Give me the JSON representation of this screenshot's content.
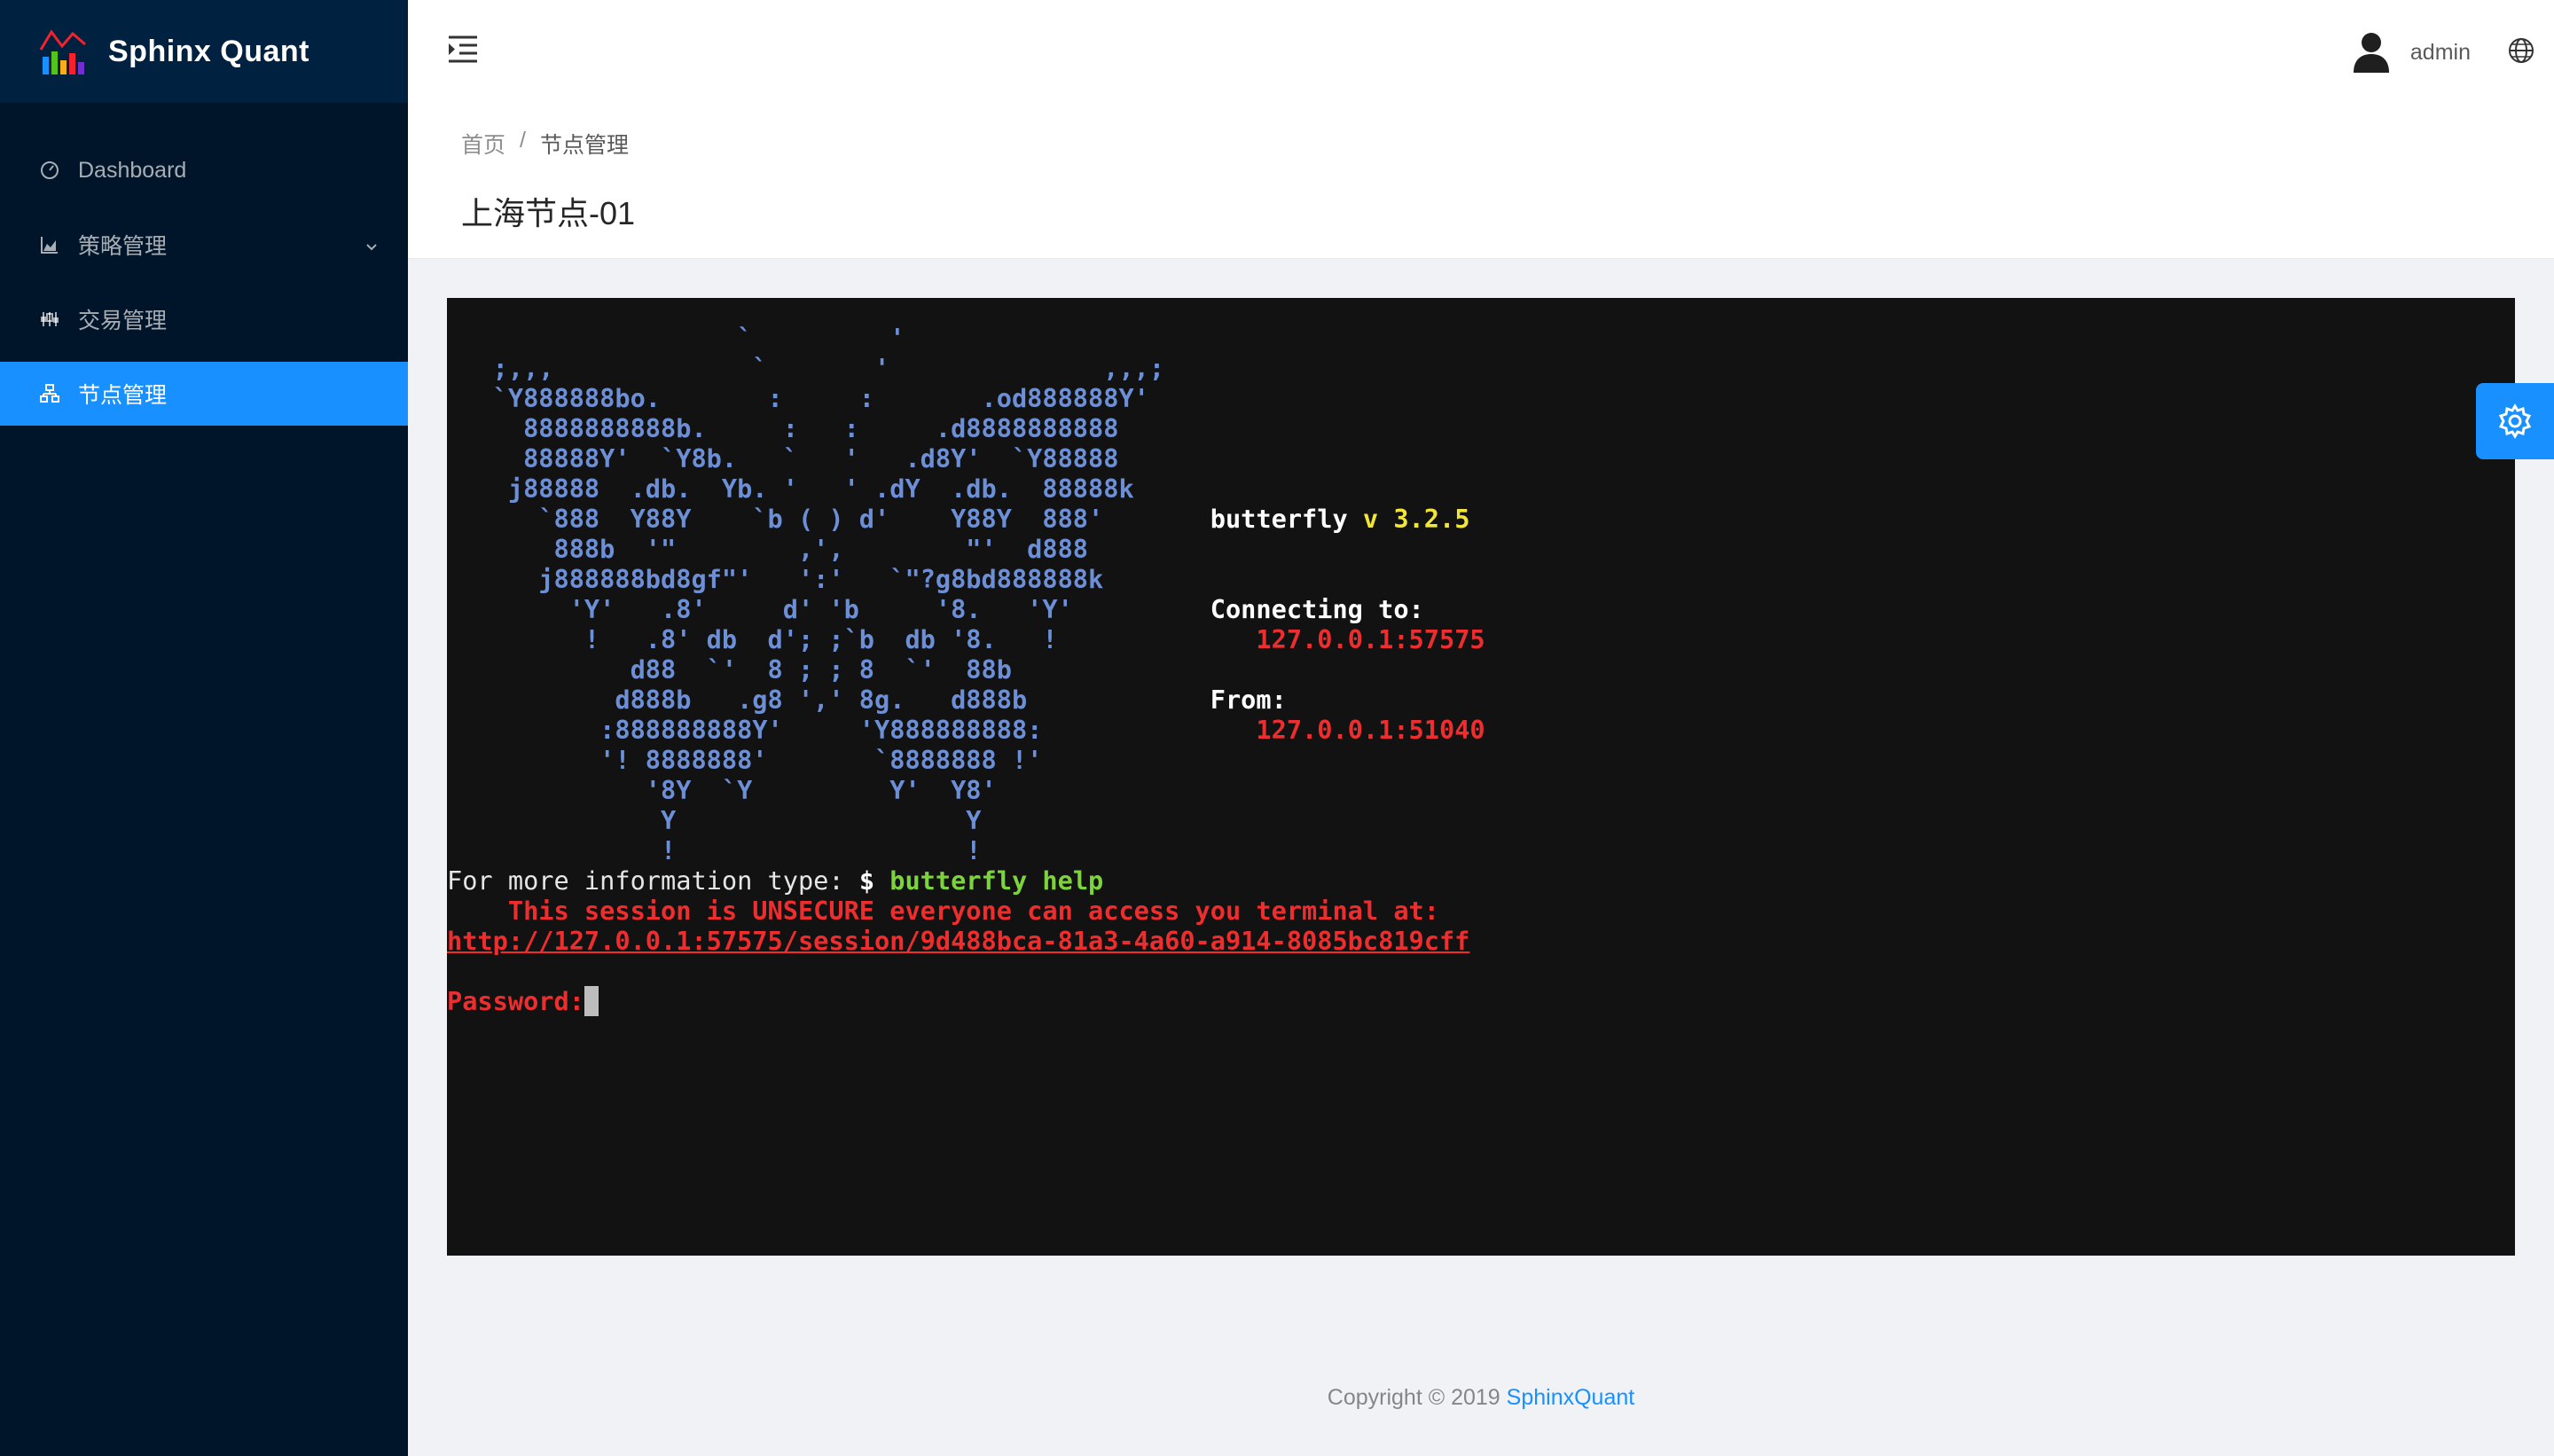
{
  "app": {
    "title": "Sphinx Quant"
  },
  "sidebar": {
    "items": [
      {
        "label": "Dashboard",
        "icon": "dashboard-icon"
      },
      {
        "label": "策略管理",
        "icon": "area-chart-icon",
        "has_children": true
      },
      {
        "label": "交易管理",
        "icon": "sliders-icon"
      },
      {
        "label": "节点管理",
        "icon": "cluster-icon",
        "selected": true
      }
    ]
  },
  "header": {
    "username": "admin"
  },
  "breadcrumb": {
    "home": "首页",
    "sep": "/",
    "current": "节点管理"
  },
  "page": {
    "title": "上海节点-01"
  },
  "terminal": {
    "art": [
      "                   `         '",
      "   ;,,,             `       '              ,,,;",
      "   `Y888888bo.       :     :       .od888888Y'",
      "     8888888888b.     :   :     .d8888888888",
      "     88888Y'  `Y8b.   `   '   .d8Y'  `Y88888",
      "    j88888  .db.  Yb. '   ' .dY  .db.  88888k",
      "      `888  Y88Y    `b ( ) d'    Y88Y  888'",
      "       888b  '\"        ,',        \"'  d888",
      "      j888888bd8gf\"'   ':'   `\"?g8bd888888k",
      "        'Y'   .8'     d' 'b     '8.   'Y'",
      "         !   .8' db  d'; ;`b  db '8.   !",
      "            d88  `'  8 ; ; 8  `'  88b",
      "           d888b   .g8 ',' 8g.   d888b",
      "          :888888888Y'     'Y888888888:",
      "          '! 8888888'       `8888888 !'",
      "             '8Y  `Y         Y'  Y8'",
      "              Y                   Y",
      "              !                   !"
    ],
    "product": "butterfly",
    "version": "v 3.2.5",
    "connecting_label": "Connecting to:",
    "connecting_addr": "127.0.0.1:57575",
    "from_label": "From:",
    "from_addr": "127.0.0.1:51040",
    "info_prefix": "For more information type: ",
    "info_dollar": "$ ",
    "info_cmd": "butterfly help",
    "warning": "    This session is UNSECURE everyone can access you terminal at:",
    "session_url": "http://127.0.0.1:57575/session/9d488bca-81a3-4a60-a914-8085bc819cff",
    "password_prompt": "Password:"
  },
  "footer": {
    "copyright": "Copyright © 2019 ",
    "brand": "SphinxQuant"
  },
  "colors": {
    "sider": "#001529",
    "accent": "#1890ff",
    "terminal_bg": "#121212"
  }
}
